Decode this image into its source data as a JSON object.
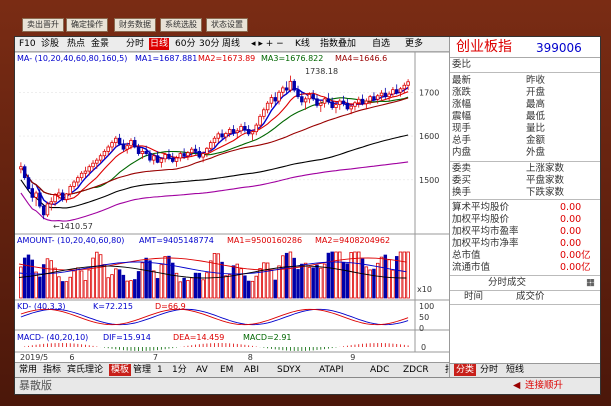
{
  "top_buttons": [
    "卖出晋升",
    "确定操作",
    "财务数据",
    "系统选股",
    "状态设置"
  ],
  "toolbar": {
    "f10": "F10",
    "diagnose": "诊股",
    "stock_comment": "热点",
    "money": "金景",
    "tabs": [
      "分时",
      "日线",
      "60分",
      "30分",
      "周线"
    ],
    "active_tab": "日线",
    "kline": "K线",
    "indicator_overlay": "指数叠加",
    "self_select": "自选",
    "more": "更多"
  },
  "ma_line": {
    "label_ma": "MA",
    "params": "(10,20,40,60,80,160,5)",
    "ma1": "MA1=1687.881",
    "ma2": "MA2=1673.89",
    "ma3": "MA3=1676.822",
    "ma4": "MA4=1646.6"
  },
  "amount_line": {
    "label": "AMOUNT",
    "params": "(10,20,40,60,80)",
    "amt": "AMT=9405148774",
    "ma1": "MA1=9500160286",
    "ma2": "MA2=9408204962"
  },
  "kd_line": {
    "label": "KD",
    "params": "(40,3,3)",
    "k": "K=72.215",
    "d": "D=66.9"
  },
  "macd_line": {
    "label": "MACD",
    "params": "(40,20,10)",
    "dif": "DIF=15.914",
    "dea": "DEA=14.459",
    "macd": "MACD=2.91"
  },
  "chart_data": {
    "type": "candlestick",
    "price_ticks": [
      "1700",
      "1600",
      "1500"
    ],
    "price_ylim": [
      1390,
      1760
    ],
    "high_label": "1738.18",
    "low_label": "1410.57",
    "amount_unit": "x10",
    "kd_ticks": [
      "100",
      "50",
      "0"
    ],
    "macd_ticks": [
      "0"
    ],
    "x_labels": [
      "2019/5",
      "6",
      "7",
      "8",
      "9",
      "10",
      "11"
    ],
    "x_label_positions": [
      0,
      13,
      35,
      60,
      87,
      113,
      135
    ],
    "candles": [
      [
        1525,
        1540,
        1515,
        1530
      ],
      [
        1530,
        1535,
        1500,
        1505
      ],
      [
        1505,
        1512,
        1475,
        1480
      ],
      [
        1480,
        1490,
        1450,
        1460
      ],
      [
        1460,
        1475,
        1440,
        1470
      ],
      [
        1470,
        1480,
        1435,
        1440
      ],
      [
        1440,
        1445,
        1410,
        1420
      ],
      [
        1420,
        1450,
        1415,
        1445
      ],
      [
        1445,
        1460,
        1430,
        1450
      ],
      [
        1450,
        1470,
        1440,
        1465
      ],
      [
        1465,
        1480,
        1455,
        1470
      ],
      [
        1470,
        1478,
        1450,
        1455
      ],
      [
        1455,
        1470,
        1448,
        1468
      ],
      [
        1468,
        1490,
        1460,
        1485
      ],
      [
        1485,
        1500,
        1478,
        1495
      ],
      [
        1495,
        1510,
        1485,
        1505
      ],
      [
        1505,
        1520,
        1498,
        1515
      ],
      [
        1515,
        1530,
        1505,
        1520
      ],
      [
        1520,
        1535,
        1510,
        1530
      ],
      [
        1530,
        1545,
        1520,
        1538
      ],
      [
        1538,
        1550,
        1525,
        1545
      ],
      [
        1545,
        1560,
        1538,
        1555
      ],
      [
        1555,
        1570,
        1548,
        1565
      ],
      [
        1565,
        1580,
        1555,
        1575
      ],
      [
        1575,
        1590,
        1565,
        1585
      ],
      [
        1585,
        1600,
        1575,
        1595
      ],
      [
        1595,
        1605,
        1578,
        1582
      ],
      [
        1582,
        1592,
        1565,
        1570
      ],
      [
        1570,
        1585,
        1560,
        1578
      ],
      [
        1578,
        1595,
        1570,
        1590
      ],
      [
        1590,
        1598,
        1572,
        1575
      ],
      [
        1575,
        1582,
        1555,
        1560
      ],
      [
        1560,
        1572,
        1548,
        1565
      ],
      [
        1565,
        1578,
        1555,
        1560
      ],
      [
        1560,
        1568,
        1540,
        1545
      ],
      [
        1545,
        1560,
        1535,
        1555
      ],
      [
        1555,
        1565,
        1538,
        1540
      ],
      [
        1540,
        1552,
        1528,
        1548
      ],
      [
        1548,
        1562,
        1540,
        1558
      ],
      [
        1558,
        1570,
        1545,
        1550
      ],
      [
        1550,
        1562,
        1538,
        1542
      ],
      [
        1542,
        1555,
        1530,
        1550
      ],
      [
        1550,
        1565,
        1542,
        1560
      ],
      [
        1560,
        1572,
        1548,
        1555
      ],
      [
        1555,
        1566,
        1545,
        1562
      ],
      [
        1562,
        1575,
        1552,
        1570
      ],
      [
        1570,
        1580,
        1558,
        1565
      ],
      [
        1565,
        1575,
        1548,
        1552
      ],
      [
        1552,
        1565,
        1540,
        1560
      ],
      [
        1560,
        1575,
        1552,
        1572
      ],
      [
        1572,
        1590,
        1565,
        1585
      ],
      [
        1585,
        1600,
        1575,
        1595
      ],
      [
        1595,
        1610,
        1585,
        1605
      ],
      [
        1605,
        1615,
        1590,
        1598
      ],
      [
        1598,
        1610,
        1588,
        1606
      ],
      [
        1606,
        1620,
        1598,
        1615
      ],
      [
        1615,
        1625,
        1600,
        1608
      ],
      [
        1608,
        1618,
        1595,
        1612
      ],
      [
        1612,
        1628,
        1605,
        1622
      ],
      [
        1622,
        1632,
        1608,
        1615
      ],
      [
        1615,
        1625,
        1600,
        1605
      ],
      [
        1605,
        1615,
        1590,
        1610
      ],
      [
        1610,
        1630,
        1602,
        1625
      ],
      [
        1625,
        1650,
        1618,
        1645
      ],
      [
        1645,
        1665,
        1638,
        1660
      ],
      [
        1660,
        1680,
        1652,
        1675
      ],
      [
        1675,
        1695,
        1665,
        1688
      ],
      [
        1688,
        1700,
        1670,
        1680
      ],
      [
        1680,
        1705,
        1672,
        1700
      ],
      [
        1700,
        1715,
        1690,
        1710
      ],
      [
        1710,
        1725,
        1695,
        1705
      ],
      [
        1705,
        1738,
        1700,
        1725
      ],
      [
        1725,
        1730,
        1700,
        1705
      ],
      [
        1705,
        1715,
        1685,
        1690
      ],
      [
        1690,
        1700,
        1670,
        1678
      ],
      [
        1678,
        1690,
        1660,
        1685
      ],
      [
        1685,
        1700,
        1675,
        1695
      ],
      [
        1695,
        1705,
        1680,
        1685
      ],
      [
        1685,
        1695,
        1665,
        1670
      ],
      [
        1670,
        1682,
        1655,
        1675
      ],
      [
        1675,
        1690,
        1665,
        1685
      ],
      [
        1685,
        1698,
        1672,
        1678
      ],
      [
        1678,
        1688,
        1660,
        1665
      ],
      [
        1665,
        1678,
        1652,
        1672
      ],
      [
        1672,
        1685,
        1660,
        1680
      ],
      [
        1680,
        1692,
        1668,
        1675
      ],
      [
        1675,
        1685,
        1658,
        1662
      ],
      [
        1662,
        1675,
        1650,
        1668
      ],
      [
        1668,
        1680,
        1658,
        1676
      ],
      [
        1676,
        1690,
        1665,
        1684
      ],
      [
        1684,
        1695,
        1670,
        1674
      ],
      [
        1674,
        1686,
        1662,
        1680
      ],
      [
        1680,
        1694,
        1672,
        1690
      ],
      [
        1690,
        1700,
        1678,
        1684
      ],
      [
        1684,
        1696,
        1674,
        1692
      ],
      [
        1692,
        1705,
        1682,
        1698
      ],
      [
        1698,
        1710,
        1685,
        1690
      ],
      [
        1690,
        1702,
        1680,
        1696
      ],
      [
        1696,
        1712,
        1688,
        1706
      ],
      [
        1706,
        1718,
        1695,
        1700
      ],
      [
        1700,
        1712,
        1690,
        1708
      ],
      [
        1708,
        1722,
        1698,
        1716
      ],
      [
        1716,
        1730,
        1705,
        1724
      ]
    ]
  },
  "right_panel": {
    "title": "创业板指",
    "code": "399006",
    "weibi": "委比",
    "rows_left": [
      "最新",
      "涨跌",
      "涨幅",
      "震幅",
      "现手",
      "总手",
      "内盘"
    ],
    "rows_right": [
      "昨收",
      "开盘",
      "最高",
      "最低",
      "量比",
      "金额",
      "外盘"
    ],
    "rows_left2": [
      "委卖",
      "委买",
      "换手"
    ],
    "rows_right2": [
      "上涨家数",
      "平盘家数",
      "下跌家数"
    ],
    "avg_rows": [
      {
        "label": "算术平均股价",
        "value": "0.00"
      },
      {
        "label": "加权平均股价",
        "value": "0.00"
      },
      {
        "label": "加权平均市盈率",
        "value": "0.00"
      },
      {
        "label": "加权平均市净率",
        "value": "0.00"
      },
      {
        "label": "总市值",
        "value": "0.00亿"
      },
      {
        "label": "流通市值",
        "value": "0.00亿"
      }
    ],
    "fen_title": "分时成交",
    "fen_cols": [
      "时间",
      "成交价"
    ]
  },
  "bottom_tabs": [
    "常用",
    "指标",
    "宾氏理论",
    "模板",
    "管理",
    "1",
    "1分",
    "AV",
    "EM",
    "ABI",
    "SDYX",
    "ATAPI",
    "ADC",
    "ZDCR",
    "指标分享"
  ],
  "bottom_active": "模板",
  "right_tabs": [
    "分类",
    "分时",
    "短线"
  ],
  "right_tabs_active": "分类",
  "status": {
    "left": "暴散版",
    "time": "",
    "connect": "连接顺升"
  }
}
